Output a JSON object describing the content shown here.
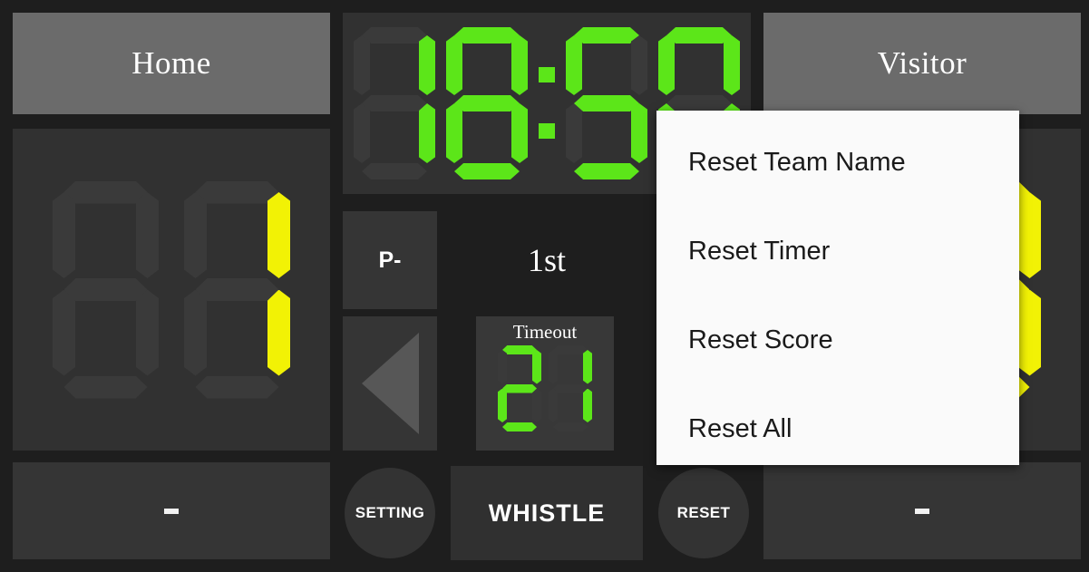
{
  "app": {
    "name": "Scoreboard",
    "background_color": "#1e1e1e",
    "panel_color": "#333333",
    "header_color": "#6b6b6b",
    "timer_color": "#5ce619",
    "score_color": "#f2f205",
    "menu_background": "#fafafa",
    "menu_text_color": "#1a1a1a"
  },
  "home": {
    "name": "Home",
    "score": "1",
    "score_digits": [
      "",
      "1"
    ],
    "minus_label": "-"
  },
  "visitor": {
    "name": "Visitor",
    "score": "9",
    "score_digits": [
      "",
      "9"
    ],
    "minus_label": "-"
  },
  "timer": {
    "value": "18:50",
    "digits": [
      "1",
      "8",
      "5",
      "0"
    ],
    "separator": ":"
  },
  "center": {
    "period_button_label": "P-",
    "period_label": "1st",
    "prev_arrow_icon": "triangle-left-icon",
    "timeout": {
      "label": "Timeout",
      "value": "21",
      "digits": [
        "2",
        "1"
      ]
    }
  },
  "bottom_bar": {
    "setting_label": "SETTING",
    "whistle_label": "WHISTLE",
    "reset_label": "RESET"
  },
  "menu": {
    "open": true,
    "items": [
      {
        "label": "Reset Team Name"
      },
      {
        "label": "Reset Timer"
      },
      {
        "label": "Reset Score"
      },
      {
        "label": "Reset All"
      }
    ]
  }
}
